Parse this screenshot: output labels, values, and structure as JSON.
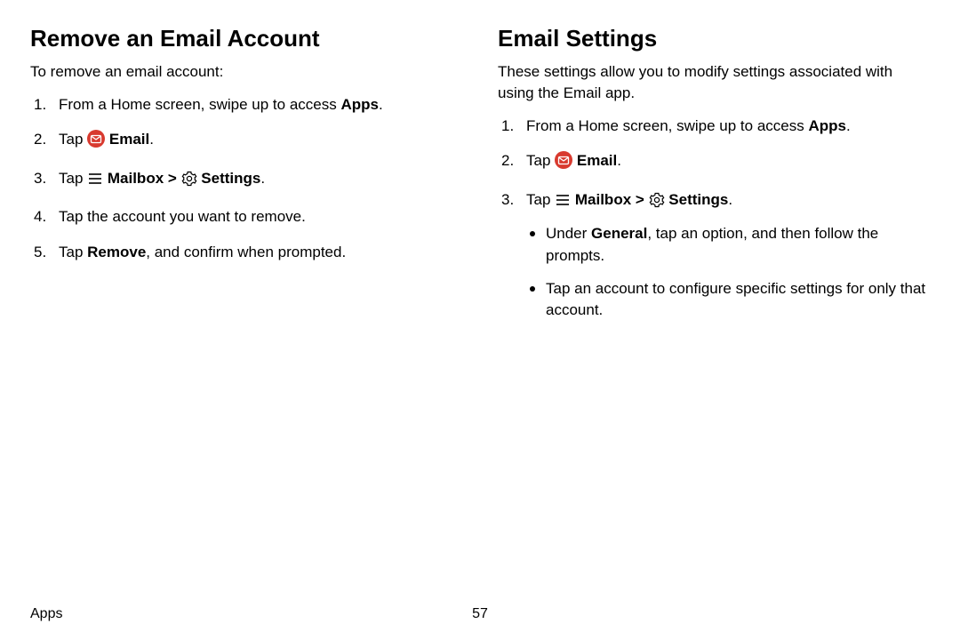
{
  "left": {
    "heading": "Remove an Email Account",
    "intro": "To remove an email account:",
    "step1_a": "From a Home screen, swipe up to access ",
    "step1_b": "Apps",
    "step1_c": ".",
    "step2_a": "Tap ",
    "step2_b": "Email",
    "step2_c": ".",
    "step3_a": "Tap ",
    "step3_b": "Mailbox",
    "step3_c": " > ",
    "step3_d": "Settings",
    "step3_e": ".",
    "step4": "Tap the account you want to remove.",
    "step5_a": "Tap ",
    "step5_b": "Remove",
    "step5_c": ", and confirm when prompted."
  },
  "right": {
    "heading": "Email Settings",
    "intro": "These settings allow you to modify settings associated with using the Email app.",
    "step1_a": "From a Home screen, swipe up to access ",
    "step1_b": "Apps",
    "step1_c": ".",
    "step2_a": "Tap ",
    "step2_b": "Email",
    "step2_c": ".",
    "step3_a": "Tap ",
    "step3_b": "Mailbox",
    "step3_c": " > ",
    "step3_d": "Settings",
    "step3_e": ".",
    "sub1_a": "Under ",
    "sub1_b": "General",
    "sub1_c": ", tap an option, and then follow the prompts.",
    "sub2": "Tap an account to configure specific settings for only that account."
  },
  "footer": {
    "section": "Apps",
    "page": "57"
  },
  "colors": {
    "email_icon": "#d83a2f"
  }
}
